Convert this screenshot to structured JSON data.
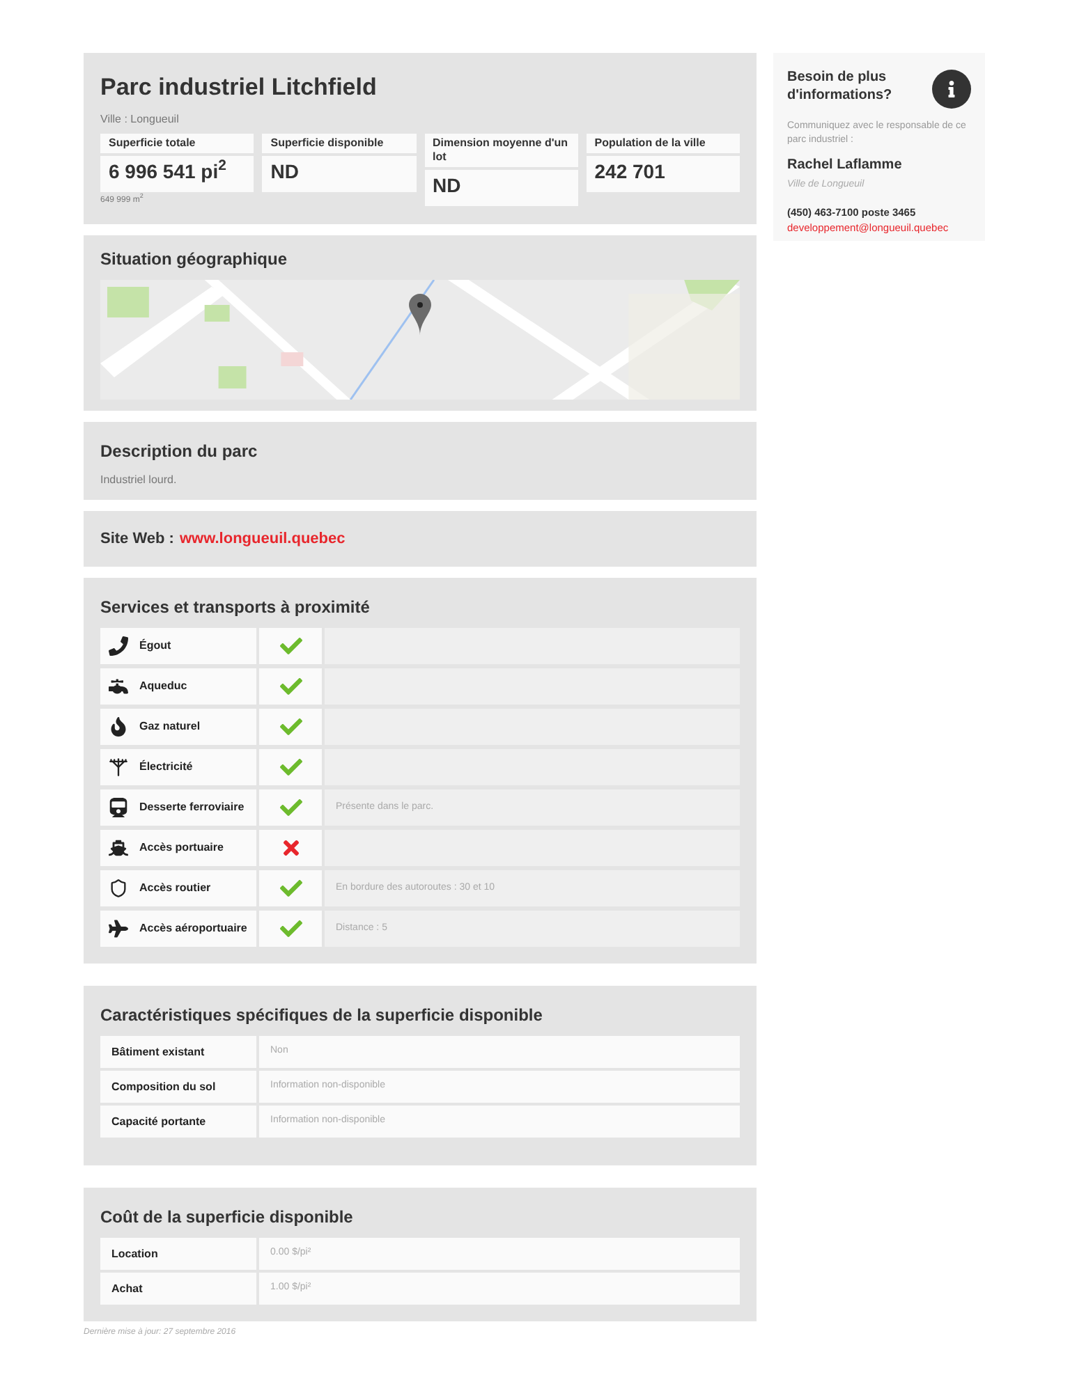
{
  "park": {
    "title": "Parc industriel Litchfield",
    "city": "Ville : Longueuil"
  },
  "stats": [
    {
      "label": "Superficie totale",
      "value": "6 996 541 pi$^{2}$",
      "sub": "649 999 m$^{2}$"
    },
    {
      "label": "Superficie disponible",
      "value": "ND"
    },
    {
      "label": "Dimension moyenne d'un lot",
      "value": "ND"
    },
    {
      "label": "Population de la ville",
      "value": "242 701"
    }
  ],
  "map_section": {
    "title": "Situation géographique"
  },
  "description": {
    "title": "Description du parc",
    "text": "Industriel lourd."
  },
  "website": {
    "label": "Site Web :",
    "link": "www.longueuil.quebec"
  },
  "services": {
    "title": "Services et transports à proximité",
    "rows": [
      {
        "label": "Égout",
        "available": true
      },
      {
        "label": "Aqueduc",
        "available": true
      },
      {
        "label": "Gaz naturel",
        "available": true
      },
      {
        "label": "Électricité",
        "available": true
      },
      {
        "label": "Desserte ferroviaire",
        "available": true,
        "note": "Présente dans le parc."
      },
      {
        "label": "Accès portuaire",
        "available": false
      },
      {
        "label": "Accès routier",
        "available": true,
        "note": "En bordure des autoroutes : 30 et 10"
      },
      {
        "label": "Accès aéroportuaire",
        "available": true,
        "note": "Distance : 5"
      }
    ]
  },
  "characteristics": {
    "title": "Caractéristiques spécifiques de la superficie disponible",
    "rows": [
      {
        "label": "Bâtiment existant",
        "value": "Non"
      },
      {
        "label": "Composition du sol",
        "value": "Information non-disponible"
      },
      {
        "label": "Capacité portante",
        "value": "Information non-disponible"
      }
    ]
  },
  "costs": {
    "title": "Coût de la superficie disponible",
    "rows": [
      {
        "label": "Location",
        "value": "0.00 $/pi²"
      },
      {
        "label": "Achat",
        "value": "1.00 $/pi²"
      }
    ]
  },
  "updated": "Dernière mise à jour: 27 septembre 2016",
  "contact": {
    "title": "Besoin de plus d'informations?",
    "intro": "Communiquez avec le responsable de ce parc industriel :",
    "name": "Rachel Laflamme",
    "org": "Ville de Longueuil",
    "phone": "(450) 463-7100 poste 3465",
    "email": "developpement@longueuil.quebec"
  }
}
